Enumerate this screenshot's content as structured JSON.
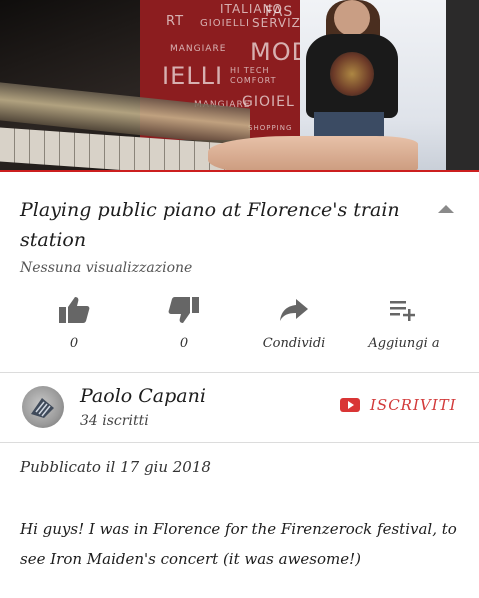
{
  "video": {
    "poster_words": [
      "ITALIANO",
      "RT",
      "GIOIELLI",
      "FAS",
      "SERVIZ",
      "MANGIARE",
      "MOD",
      "IELLI",
      "HI TECH",
      "COMFORT",
      "MANGIARE",
      "GIOIEL",
      "SHOPPING"
    ]
  },
  "title": "Playing public piano at Florence's train station",
  "views": "Nessuna visualizzazione",
  "actions": {
    "like_count": "0",
    "dislike_count": "0",
    "share_label": "Condividi",
    "add_label": "Aggiungi a"
  },
  "channel": {
    "name": "Paolo Capani",
    "subscribers": "34 iscritti",
    "subscribe_label": "ISCRIVITI"
  },
  "published": "Pubblicato il 17 giu 2018",
  "description": "Hi guys! I was in Florence for the Firenzerock festival, to see Iron Maiden's concert (it was awesome!)",
  "colors": {
    "accent": "#d23a3a",
    "progress_bar": "#cc1f1f"
  }
}
